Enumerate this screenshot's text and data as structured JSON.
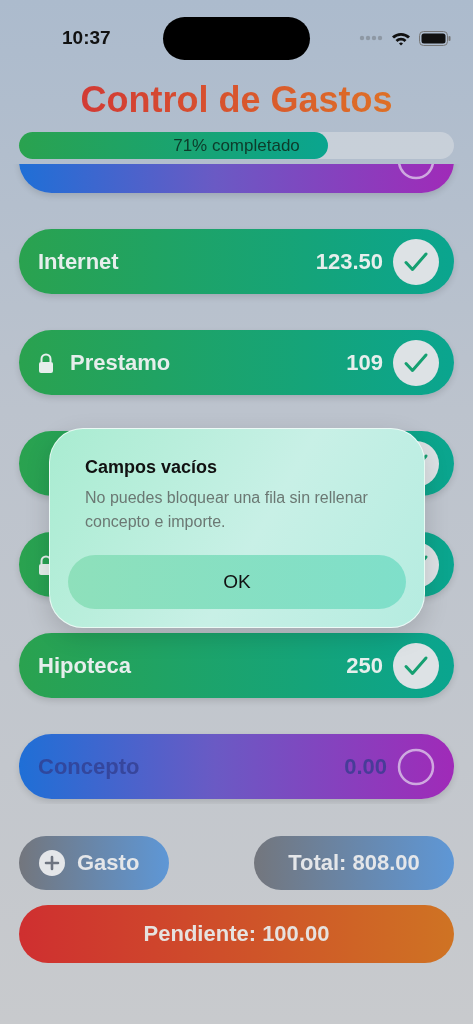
{
  "status_bar": {
    "time": "10:37"
  },
  "title": "Control de Gastos",
  "progress": {
    "label": "71% completado",
    "level": 0.71
  },
  "rows": [
    {
      "kind": "entry",
      "checked": false,
      "locked": false
    },
    {
      "kind": "entry",
      "concept": "Internet",
      "amount": "123.50",
      "checked": true,
      "locked": false
    },
    {
      "kind": "entry",
      "concept": "Prestamo",
      "amount": "109",
      "checked": true,
      "locked": true
    },
    {
      "kind": "entry",
      "checked": true,
      "locked": false
    },
    {
      "kind": "entry",
      "checked": true,
      "locked": true
    },
    {
      "kind": "entry",
      "concept": "Hipoteca",
      "amount": "250",
      "checked": true,
      "locked": false
    },
    {
      "kind": "new",
      "concept_placeholder": "Concepto",
      "amount_placeholder": "0.00",
      "checked": false,
      "locked": false
    }
  ],
  "footer": {
    "add_button": "Gasto",
    "total": "Total: 808.00",
    "pending": "Pendiente: 100.00"
  },
  "alert": {
    "title": "Campos vacíos",
    "message": "No puedes bloquear una fila sin rellenar concepto e importe.",
    "button": "OK"
  }
}
